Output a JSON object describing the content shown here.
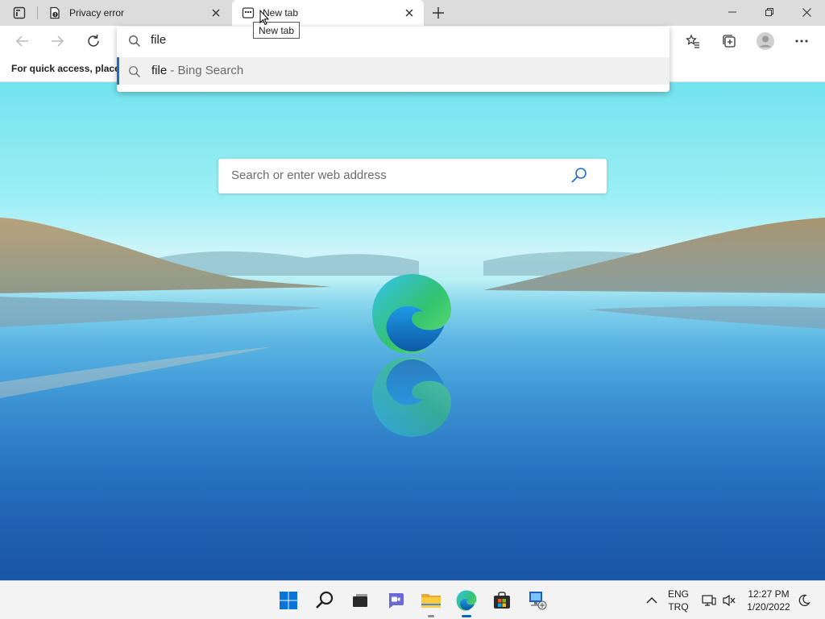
{
  "browser": {
    "tabs": [
      {
        "title": "Privacy error",
        "icon": "error-document-icon",
        "active": false
      },
      {
        "title": "New tab",
        "icon": "new-tab-icon",
        "active": true
      }
    ],
    "tooltip": "New tab",
    "favorites_bar_text": "For quick access, place y",
    "address": {
      "value": "file",
      "suggestion": {
        "query": "file",
        "source": "- Bing Search"
      }
    },
    "ntp_search_placeholder": "Search or enter web address"
  },
  "taskbar": {
    "apps": [
      "start-icon",
      "search-icon",
      "task-view-icon",
      "chat-icon",
      "file-explorer-icon",
      "edge-icon",
      "store-icon",
      "network-app-icon"
    ],
    "lang_line1": "ENG",
    "lang_line2": "TRQ",
    "time": "12:27 PM",
    "date": "1/20/2022"
  },
  "colors": {
    "accent": "#0067c0",
    "suggest_bar": "#1f6fc8",
    "tabstrip": "#dcdcdc"
  }
}
